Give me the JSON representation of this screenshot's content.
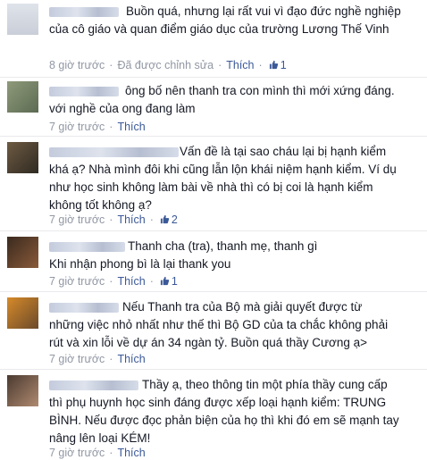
{
  "comments": [
    {
      "text": "Buồn quá, nhưng lại rất vui vì đạo đức nghề nghiệp\ncủa cô giáo và quan điểm giáo dục của trường Lương Thế Vinh",
      "time": "8 giờ trước",
      "edited": "Đã được chỉnh sửa",
      "like": "Thích",
      "likes": "1"
    },
    {
      "text": "ông bố nên thanh tra con mình thì mới xứng đáng.\nvới nghề của ong đang làm",
      "time": "7 giờ trước",
      "like": "Thích"
    },
    {
      "text": "Vấn đề là tại sao cháu lại bị hạnh kiểm\nkhá ạ? Nhà mình đôi khi cũng lẫn lộn khái niệm hạnh kiểm. Ví dụ\nnhư học sinh không làm bài về nhà thì có bị coi là hạnh kiểm\nkhông tốt không ạ?",
      "time": "7 giờ trước",
      "like": "Thích",
      "likes": "2"
    },
    {
      "text": "Thanh cha (tra), thanh mẹ, thanh gì\nKhi nhận phong bì là lại thank you",
      "time": "7 giờ trước",
      "like": "Thích",
      "likes": "1"
    },
    {
      "text": "Nếu Thanh tra của Bộ mà giải quyết được từ\nnhững việc nhỏ nhất như thế thì Bộ GD của ta chắc không phải\nrút và xin lỗi về dự án 34 ngàn tỷ. Buồn quá thầy Cương ạ>",
      "time": "7 giờ trước",
      "like": "Thích"
    },
    {
      "text": "Thầy ạ, theo thông tin một phía thầy cung cấp\nthì phụ huynh học sinh đáng được xếp loại hạnh kiểm: TRUNG\nBÌNH. Nếu được đọc phản biện của họ thì khi đó em sẽ mạnh tay\nnâng lên loại KÉM!",
      "time": "7 giờ trước",
      "like": "Thích"
    }
  ],
  "icons": {
    "like_count": "thumbs-up-icon"
  },
  "colors": {
    "link": "#3b5998",
    "meta": "#9197a3",
    "text": "#141823",
    "divider": "#e9eaed"
  }
}
